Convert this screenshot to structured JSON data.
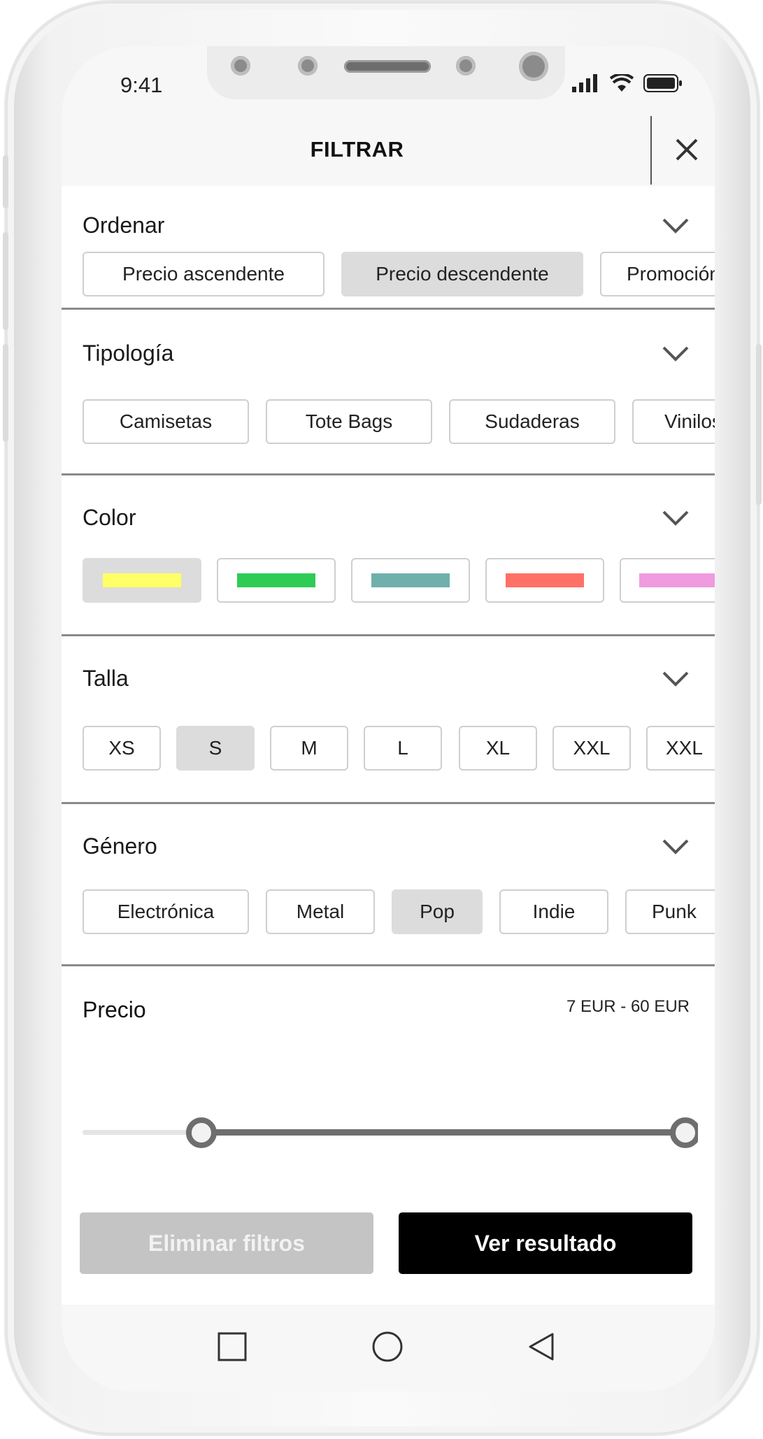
{
  "status_bar": {
    "time": "9:41"
  },
  "header": {
    "title": "FILTRAR"
  },
  "sections": {
    "ordenar": {
      "title": "Ordenar",
      "options": [
        "Precio ascendente",
        "Precio descendente",
        "Promoción"
      ],
      "selected": "Precio descendente"
    },
    "tipologia": {
      "title": "Tipología",
      "options": [
        "Camisetas",
        "Tote Bags",
        "Sudaderas",
        "Vinilos"
      ]
    },
    "color": {
      "title": "Color",
      "swatches": [
        "#ffff66",
        "#2ecc55",
        "#6fb0ac",
        "#ff7066",
        "#f09ae0"
      ],
      "selected_index": 0
    },
    "talla": {
      "title": "Talla",
      "options": [
        "XS",
        "S",
        "M",
        "L",
        "XL",
        "XXL",
        "XXL"
      ],
      "selected": "S"
    },
    "genero": {
      "title": "Género",
      "options": [
        "Electrónica",
        "Metal",
        "Pop",
        "Indie",
        "Punk"
      ],
      "selected": "Pop"
    },
    "precio": {
      "title": "Precio",
      "range_text": "7 EUR - 60 EUR",
      "min_fraction": 0.18,
      "max_fraction": 1.0
    }
  },
  "actions": {
    "clear_label": "Eliminar filtros",
    "results_label": "Ver resultado"
  },
  "nav": {
    "icons": [
      "square-icon",
      "circle-icon",
      "back-triangle-icon"
    ]
  }
}
